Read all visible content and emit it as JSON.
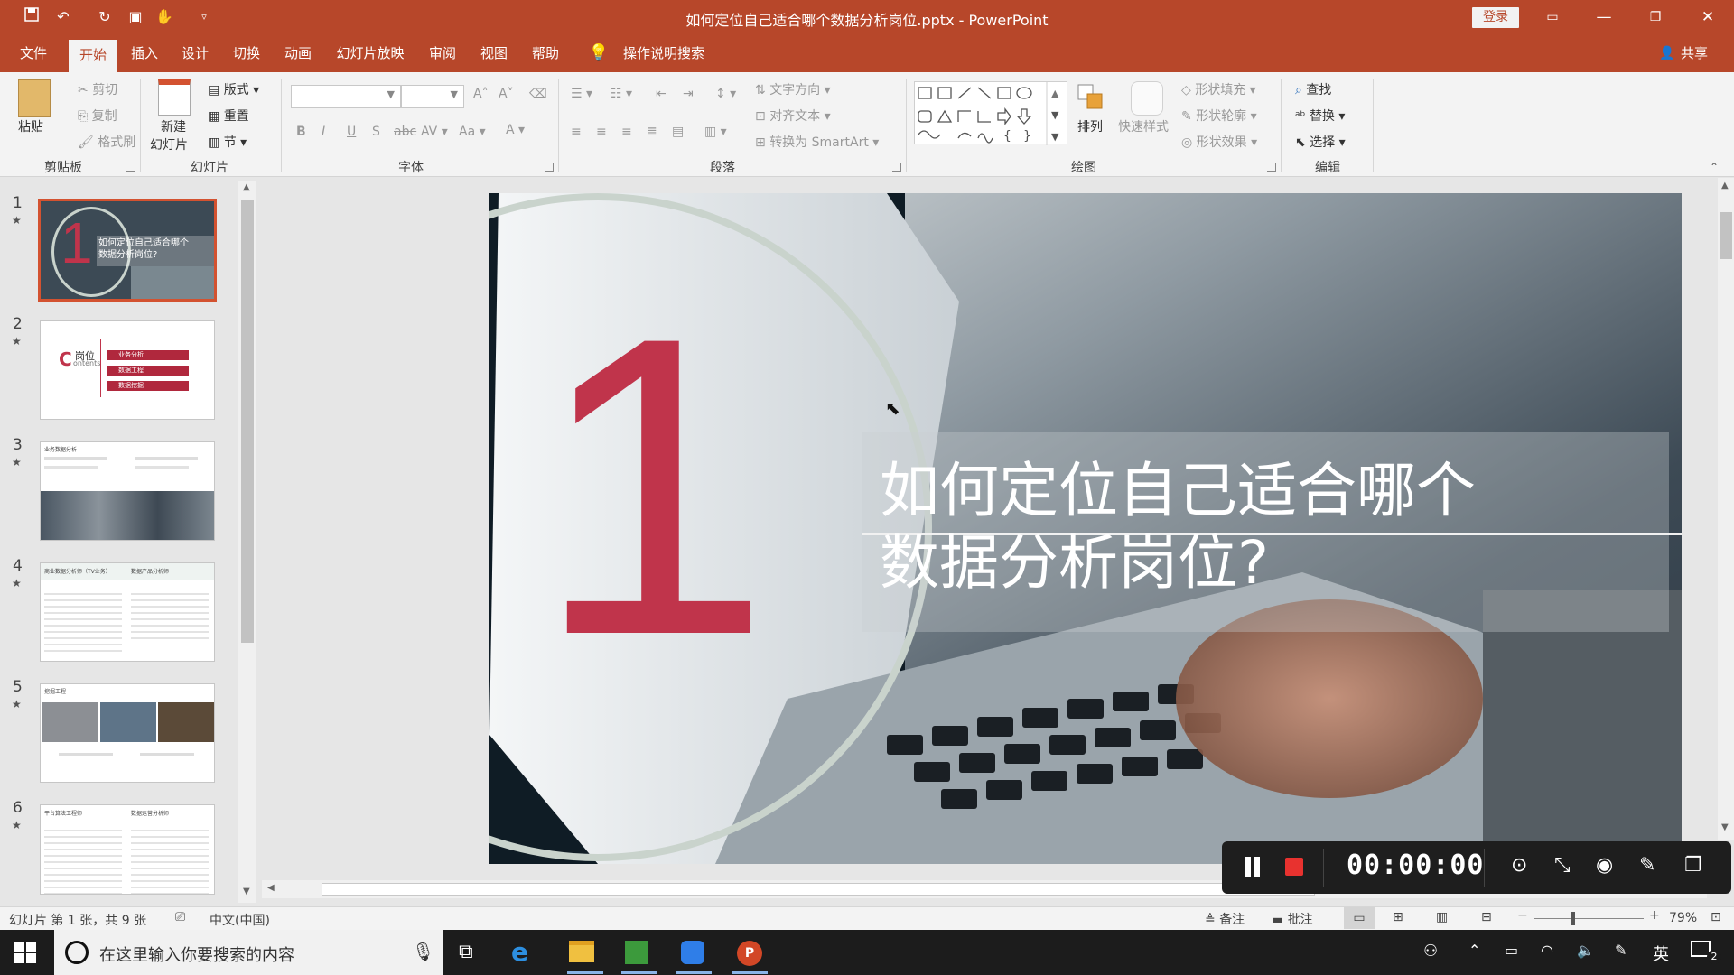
{
  "window": {
    "title": "如何定位自己适合哪个数据分析岗位.pptx  -  PowerPoint",
    "login_label": "登录",
    "share_label": "共享"
  },
  "colors": {
    "accent": "#b7472a",
    "selected_thumb": "#d35230",
    "slide_red": "#c0344b"
  },
  "tabs": [
    {
      "label": "文件"
    },
    {
      "label": "开始",
      "active": true
    },
    {
      "label": "插入"
    },
    {
      "label": "设计"
    },
    {
      "label": "切换"
    },
    {
      "label": "动画"
    },
    {
      "label": "幻灯片放映"
    },
    {
      "label": "审阅"
    },
    {
      "label": "视图"
    },
    {
      "label": "帮助"
    },
    {
      "label": "操作说明搜索"
    }
  ],
  "ribbon": {
    "clipboard": {
      "label": "剪贴板",
      "paste": "粘贴",
      "cut": "剪切",
      "copy": "复制",
      "format_painter": "格式刷"
    },
    "slides": {
      "label": "幻灯片",
      "new_slide": "新建",
      "new_slide_2": "幻灯片",
      "layout": "版式",
      "reset": "重置",
      "section": "节"
    },
    "font": {
      "label": "字体"
    },
    "paragraph": {
      "label": "段落",
      "text_direction": "文字方向",
      "align_text": "对齐文本",
      "smartart": "转换为 SmartArt"
    },
    "drawing": {
      "label": "绘图",
      "arrange": "排列",
      "quick_styles": "快速样式",
      "shape_fill": "形状填充",
      "shape_outline": "形状轮廓",
      "shape_effects": "形状效果"
    },
    "editing": {
      "label": "编辑",
      "find": "查找",
      "replace": "替换",
      "select": "选择"
    }
  },
  "thumbnails": [
    {
      "num": "1",
      "star": "★",
      "selected": true,
      "title_lines": [
        "如何定位自己适合哪个",
        "数据分析岗位?"
      ]
    },
    {
      "num": "2",
      "star": "★",
      "contents_big": "C",
      "contents_word": "岗位",
      "contents_sub": "ontents",
      "items": [
        "业务分析",
        "数据工程",
        "数据挖掘"
      ]
    },
    {
      "num": "3",
      "star": "★",
      "heading": "业务数据分析"
    },
    {
      "num": "4",
      "star": "★",
      "heading": "商业数据分析师（TV业务）",
      "heading2": "数据产品分析师"
    },
    {
      "num": "5",
      "star": "★",
      "heading": "挖掘工程"
    },
    {
      "num": "6",
      "star": "★",
      "heading": "平台算法工程师",
      "heading2": "数据运营分析师"
    }
  ],
  "slide": {
    "big_number": "1",
    "title_line1": "如何定位自己适合哪个",
    "title_line2": "数据分析岗位?"
  },
  "recorder": {
    "timer": "00:00:00"
  },
  "status": {
    "slide_info": "幻灯片 第 1 张，共 9 张",
    "language": "中文(中国)",
    "notes": "备注",
    "comments": "批注",
    "zoom": "79%"
  },
  "taskbar": {
    "search_placeholder": "在这里输入你要搜索的内容",
    "ime": "英",
    "notification_count": "2"
  }
}
